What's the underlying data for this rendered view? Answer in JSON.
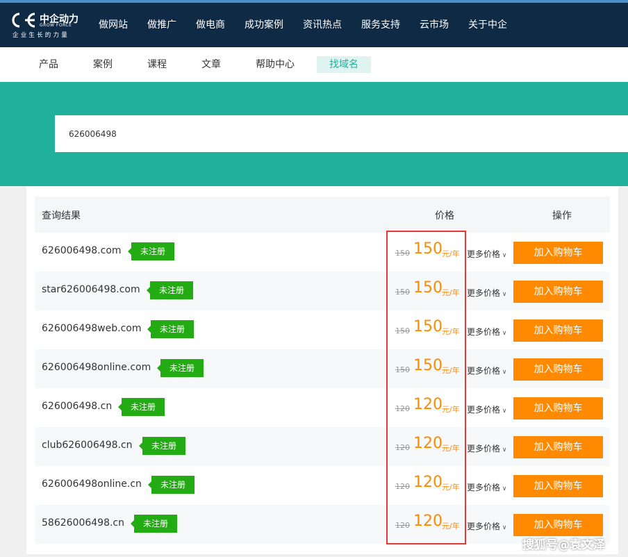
{
  "brand": {
    "name_cn": "中企动力",
    "name_en": "GROW FORCE",
    "slogan": "企业生长的力量",
    "colors": {
      "header_bg": "#0f2a44",
      "accent": "#20b09c",
      "orange": "#ff8a00",
      "green_badge": "#22ab12",
      "highlight": "#e53935"
    }
  },
  "nav": {
    "items": [
      "做网站",
      "做推广",
      "做电商",
      "成功案例",
      "资讯热点",
      "服务支持",
      "云市场",
      "关于中企"
    ]
  },
  "subnav": {
    "items": [
      "产品",
      "案例",
      "课程",
      "文章",
      "帮助中心",
      "找域名"
    ],
    "active_index": 5
  },
  "search": {
    "value": "626006498"
  },
  "table": {
    "headers": {
      "result": "查询结果",
      "price": "价格",
      "operation": "操作"
    },
    "status_label": "未注册",
    "unit": "元/年",
    "more_label": "更多价格",
    "cart_label": "加入购物车",
    "rows": [
      {
        "domain": "626006498.com",
        "old_price": "150",
        "price": "150"
      },
      {
        "domain": "star626006498.com",
        "old_price": "150",
        "price": "150"
      },
      {
        "domain": "626006498web.com",
        "old_price": "150",
        "price": "150"
      },
      {
        "domain": "626006498online.com",
        "old_price": "150",
        "price": "150"
      },
      {
        "domain": "626006498.cn",
        "old_price": "120",
        "price": "120"
      },
      {
        "domain": "club626006498.cn",
        "old_price": "120",
        "price": "120"
      },
      {
        "domain": "626006498online.cn",
        "old_price": "120",
        "price": "120"
      },
      {
        "domain": "58626006498.cn",
        "old_price": "120",
        "price": "120"
      }
    ]
  },
  "watermark": "搜狐号@袁文泽"
}
